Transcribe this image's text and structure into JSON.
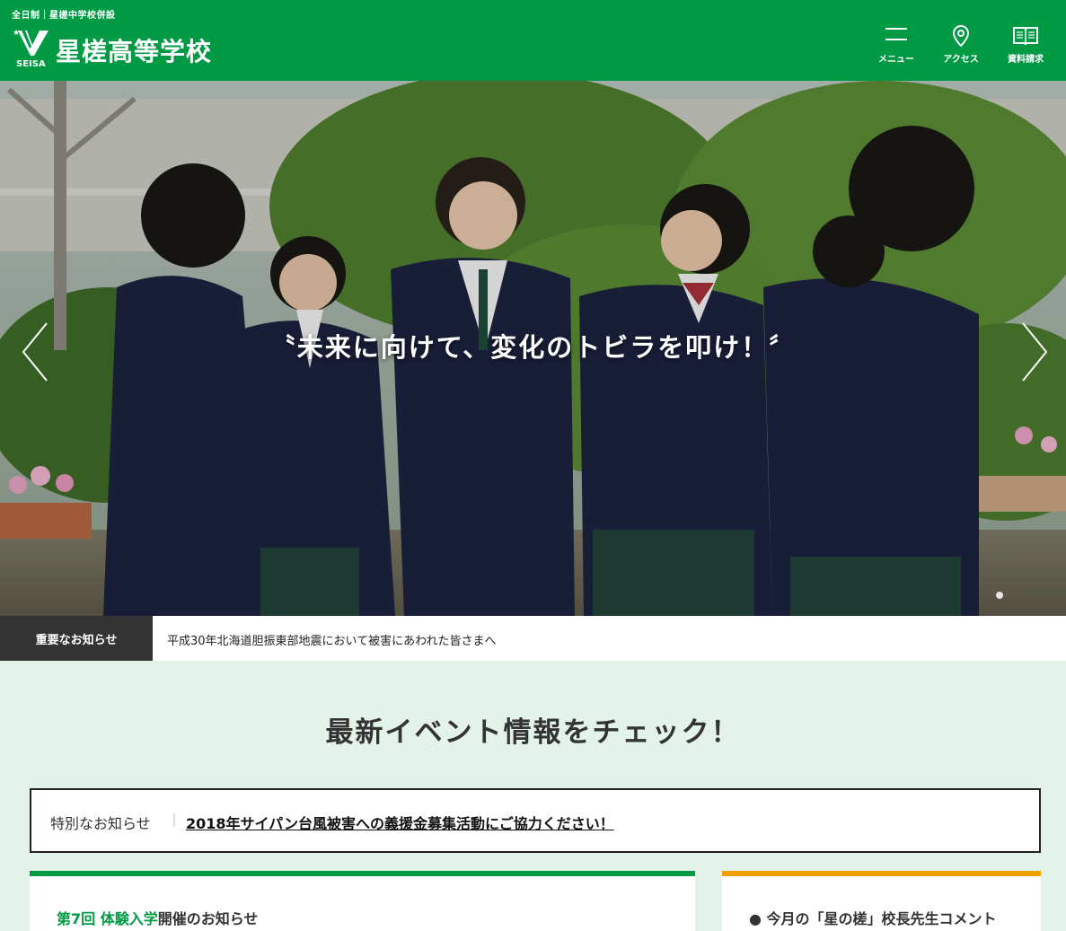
{
  "header": {
    "subtitle": "全日制｜星槎中学校併設",
    "school_name": "星槎高等学校",
    "logo_text": "SEISA",
    "nav": [
      {
        "label": "メニュー",
        "icon": "menu-icon"
      },
      {
        "label": "アクセス",
        "icon": "map-pin-icon"
      },
      {
        "label": "資料請求",
        "icon": "book-icon"
      }
    ]
  },
  "hero": {
    "caption": "〝未来に向けて、変化のトビラを叩け！〞"
  },
  "notice": {
    "label": "重要なお知らせ",
    "text": "平成30年北海道胆振東部地震において被害にあわれた皆さまへ"
  },
  "events": {
    "title": "最新イベント情報をチェック！",
    "special_label": "特別なお知らせ",
    "special_sep": "｜",
    "special_link": "2018年サイパン台風被害への義援金募集活動にご協力ください！"
  },
  "cards": {
    "left_prefix": "第7回 体験入学",
    "left_suffix": "開催のお知らせ",
    "right_title": "● 今月の「星の槎」校長先生コメント"
  },
  "colors": {
    "brand_green": "#009a44",
    "accent_orange": "#f0a000",
    "section_bg": "#e3f3ea"
  }
}
